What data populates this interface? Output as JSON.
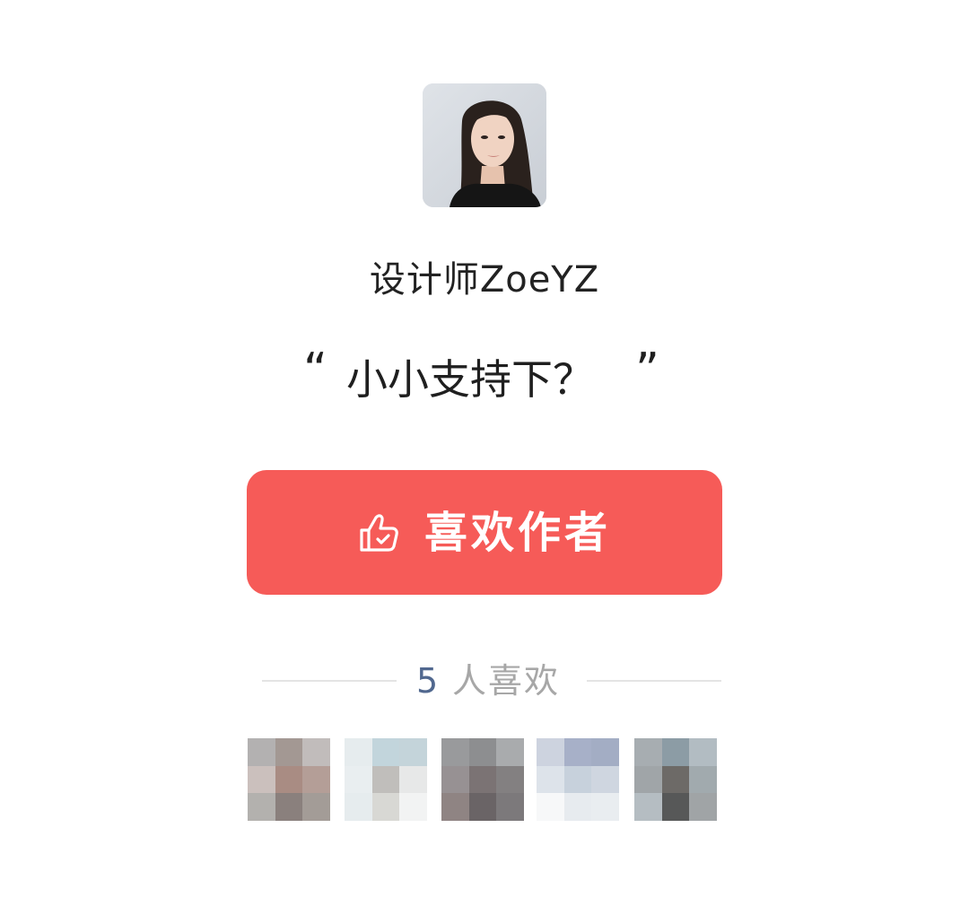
{
  "author": {
    "name": "设计师ZoeYZ"
  },
  "message": {
    "open_quote": "“",
    "text": "小小支持下？",
    "close_quote": "”"
  },
  "like_button": {
    "label": "喜欢作者",
    "icon": "thumbs-up-icon"
  },
  "likes": {
    "count": "5",
    "label": "人喜欢"
  },
  "colors": {
    "accent": "#f65b58",
    "count_color": "#51688f",
    "muted_text": "#a7a7a7"
  }
}
